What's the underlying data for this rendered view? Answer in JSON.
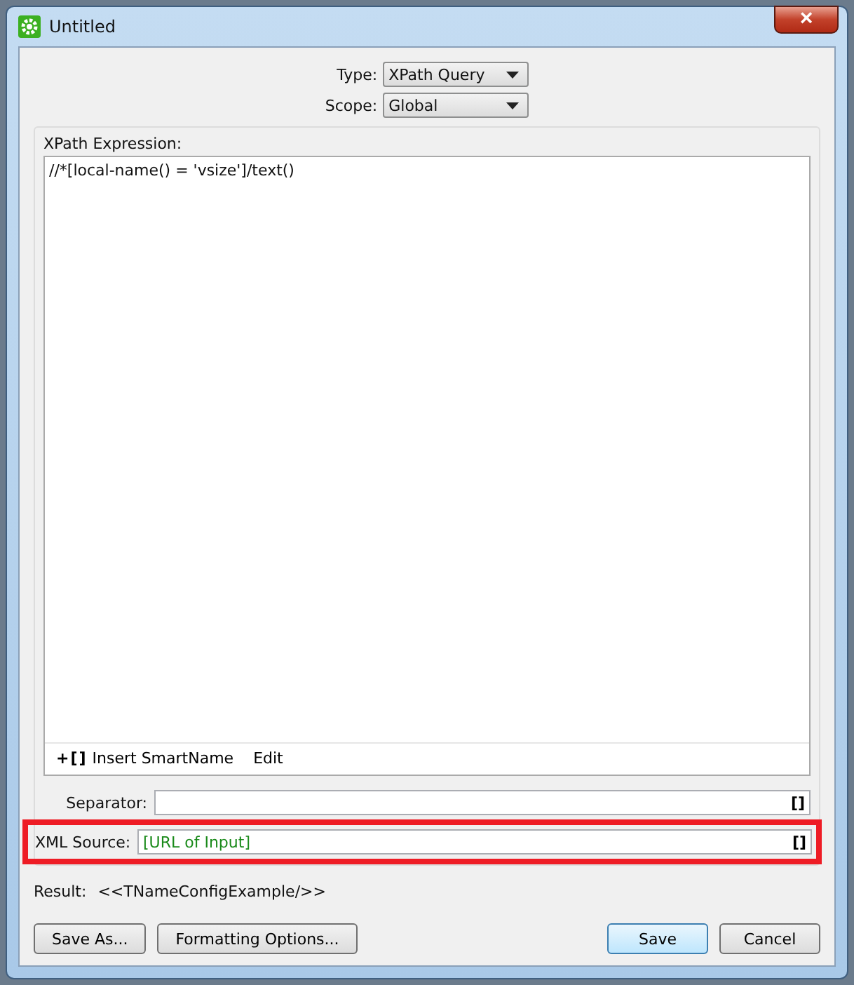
{
  "window": {
    "title": "Untitled",
    "close_glyph": "×"
  },
  "type": {
    "label": "Type:",
    "value": "XPath Query"
  },
  "scope": {
    "label": "Scope:",
    "value": "Global"
  },
  "expression": {
    "label": "XPath Expression:",
    "value": "//*[local-name() = 'vsize']/text()"
  },
  "toolbar": [
    {
      "glyph": "+[]",
      "label": "Insert SmartName"
    },
    {
      "label": "Edit"
    }
  ],
  "separator": {
    "label": "Separator:",
    "button": "[]"
  },
  "xml_source": {
    "label": "XML Source:",
    "value": "[URL of Input]",
    "button": "[]",
    "highlighted": true
  },
  "result": {
    "label": "Result:",
    "value": "<<TNameConfigExample/>>"
  },
  "left_buttons": [
    {
      "label": "Save As...",
      "default": false
    },
    {
      "label": "Formatting Options...",
      "default": false
    }
  ],
  "right_buttons": [
    {
      "label": "Save",
      "default": true
    },
    {
      "label": "Cancel",
      "default": false
    }
  ]
}
